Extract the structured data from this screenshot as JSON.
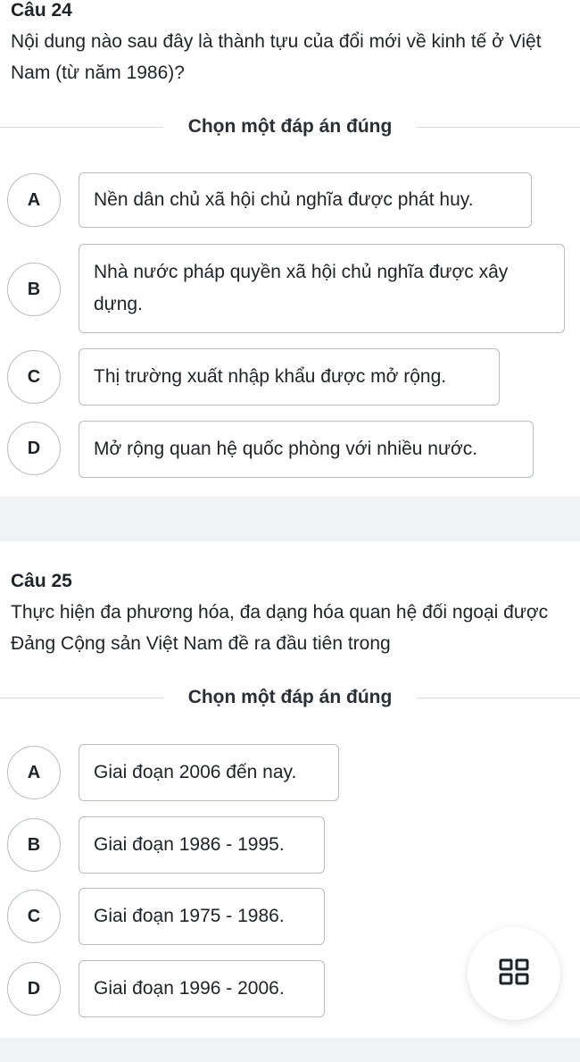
{
  "questions": [
    {
      "number": "Câu 24",
      "text": "Nội dung nào sau đây là thành tựu của đổi mới về kinh tế ở Việt Nam (từ năm 1986)?",
      "instruction": "Chọn một đáp án đúng",
      "options": [
        {
          "letter": "A",
          "text": "Nền dân chủ xã hội chủ nghĩa được phát huy."
        },
        {
          "letter": "B",
          "text": "Nhà nước pháp quyền xã hội chủ nghĩa được xây dựng."
        },
        {
          "letter": "C",
          "text": "Thị trường xuất nhập khẩu được mở rộng."
        },
        {
          "letter": "D",
          "text": "Mở rộng quan hệ quốc phòng với nhiều nước."
        }
      ]
    },
    {
      "number": "Câu 25",
      "text": "Thực hiện đa phương hóa, đa dạng hóa quan hệ đối ngoại được Đảng Cộng sản Việt Nam đề ra đầu tiên trong",
      "instruction": "Chọn một đáp án đúng",
      "options": [
        {
          "letter": "A",
          "text": "Giai đoạn 2006 đến nay."
        },
        {
          "letter": "B",
          "text": "Giai đoạn 1986 - 1995."
        },
        {
          "letter": "C",
          "text": "Giai đoạn 1975 - 1986."
        },
        {
          "letter": "D",
          "text": "Giai đoạn 1996 - 2006."
        }
      ]
    }
  ],
  "fab": {
    "icon": "grid-icon"
  }
}
